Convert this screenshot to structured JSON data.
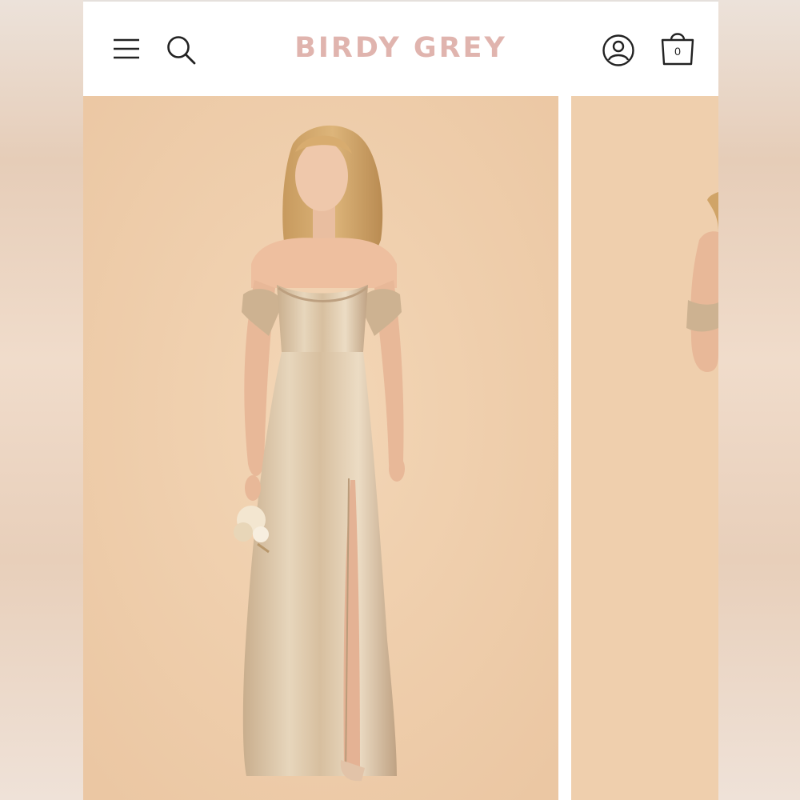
{
  "brand": {
    "name": "BIRDY GREY",
    "color": "#e0b4ae"
  },
  "header": {
    "menu_icon": "hamburger-menu-icon",
    "search_icon": "search-icon",
    "account_icon": "user-account-icon",
    "bag_icon": "shopping-bag-icon",
    "bag_count": "0"
  },
  "gallery": {
    "background_color": "#efcfad",
    "dress_color": "#d9c2a3",
    "slides": [
      {
        "description_icon": "model-front-photo"
      },
      {
        "description_icon": "model-back-photo"
      }
    ]
  }
}
